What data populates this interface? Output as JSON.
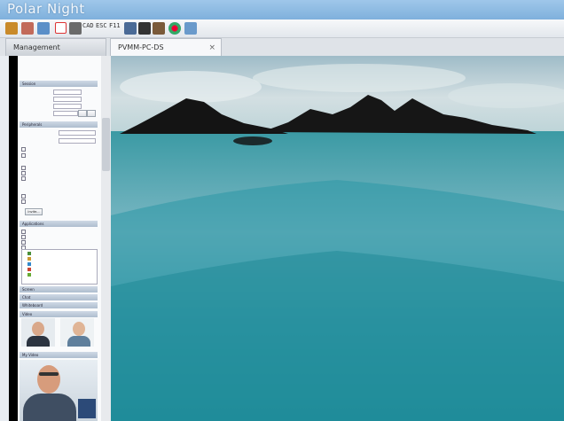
{
  "window": {
    "title": "Polar Night"
  },
  "toolbar": {
    "icons": [
      "key-icon",
      "connect-icon",
      "search-icon",
      "record-icon",
      "pen-icon",
      "wrench-icon",
      "ctrl-alt-del-icon",
      "power-icon",
      "fullscreen-icon",
      "tools-icon",
      "color-icon",
      "help-icon"
    ],
    "labels": {
      "cad": "CAD",
      "esc": "ESC",
      "f11": "F11"
    }
  },
  "tabs": [
    {
      "label": "Management"
    },
    {
      "label": "PVMM-PC-DS"
    }
  ],
  "tab_close": "×",
  "sidebar": {
    "sections": [
      {
        "label": "Session"
      },
      {
        "label": "Peripherals"
      },
      {
        "label": "Applications"
      },
      {
        "label": "Screen"
      },
      {
        "label": "Chat"
      },
      {
        "label": "Whiteboard"
      },
      {
        "label": "Video"
      },
      {
        "label": "My Video"
      }
    ],
    "button_label": "Invite..."
  },
  "colors": {
    "title_bar": "#8dbbe3",
    "sea": "#2f9aa6",
    "sky": "#b8cfd6"
  }
}
